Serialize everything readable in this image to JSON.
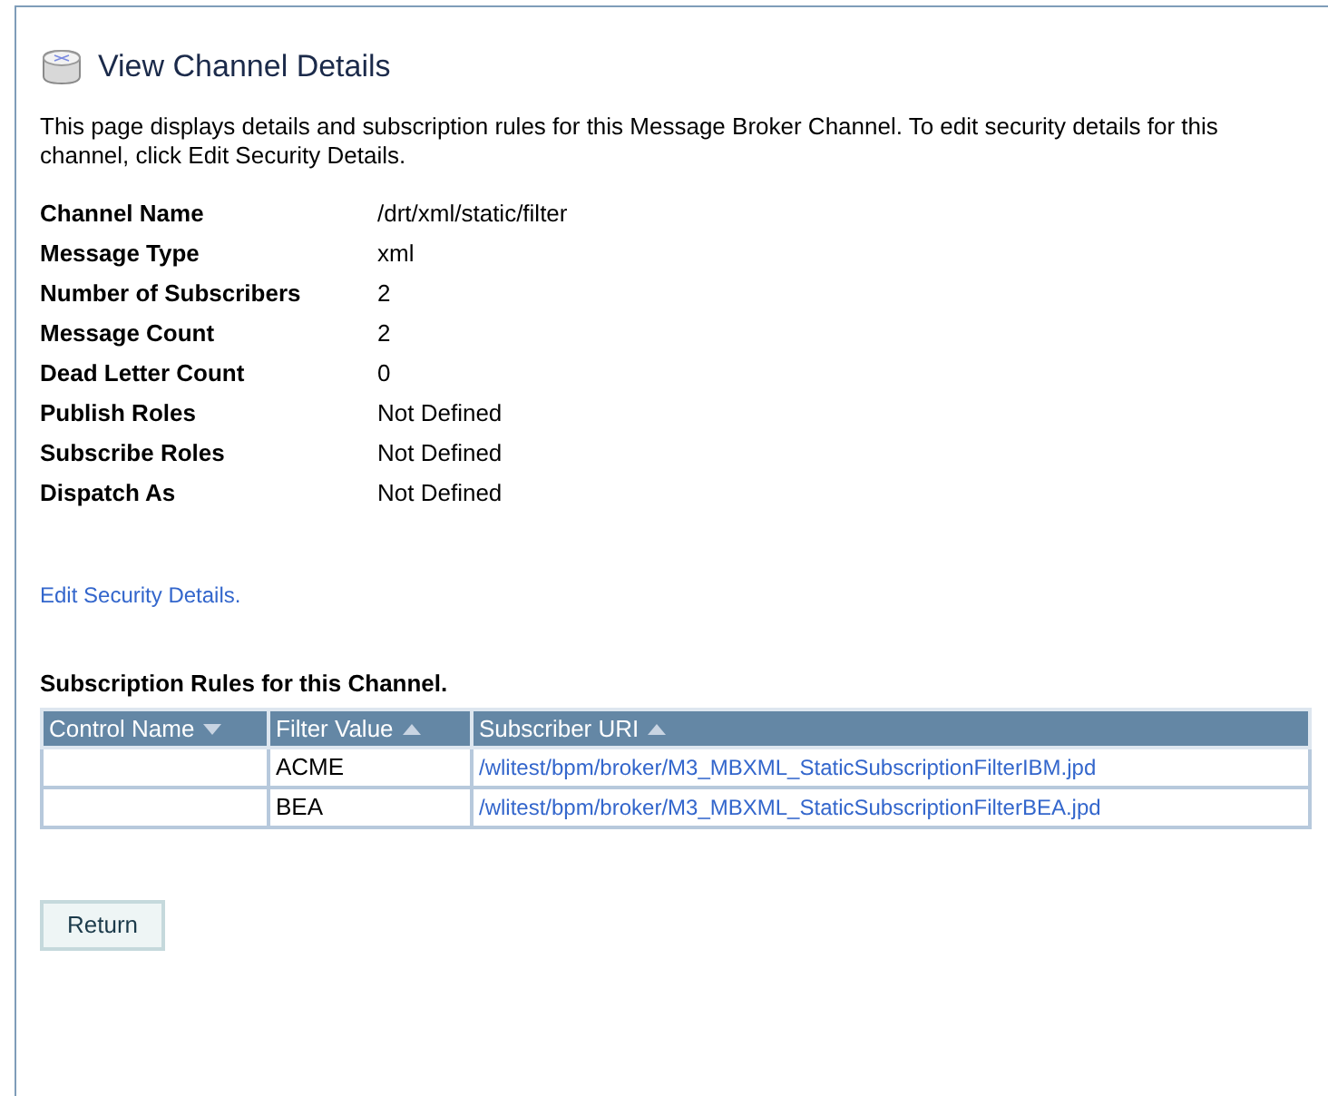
{
  "page": {
    "title": "View Channel Details",
    "description": "This page displays details and subscription rules for this Message Broker Channel. To edit security details for this channel, click Edit Security Details."
  },
  "details": [
    {
      "label": "Channel Name",
      "value": "/drt/xml/static/filter"
    },
    {
      "label": "Message Type",
      "value": "xml"
    },
    {
      "label": "Number of Subscribers",
      "value": "2"
    },
    {
      "label": "Message Count",
      "value": "2"
    },
    {
      "label": "Dead Letter Count",
      "value": "0"
    },
    {
      "label": "Publish Roles",
      "value": "Not Defined"
    },
    {
      "label": "Subscribe Roles",
      "value": "Not Defined"
    },
    {
      "label": "Dispatch As",
      "value": "Not Defined"
    }
  ],
  "edit_link": "Edit Security Details.",
  "table": {
    "title": "Subscription Rules for this Channel.",
    "columns": [
      {
        "label": "Control Name",
        "ascending": false
      },
      {
        "label": "Filter Value",
        "ascending": true
      },
      {
        "label": "Subscriber URI",
        "ascending": true
      }
    ],
    "rows": [
      {
        "filter_value": "ACME",
        "subscriber_uri": "/wlitest/bpm/broker/M3_MBXML_StaticSubscriptionFilterIBM.jpd"
      },
      {
        "filter_value": "BEA",
        "subscriber_uri": "/wlitest/bpm/broker/M3_MBXML_StaticSubscriptionFilterBEA.jpd"
      }
    ]
  },
  "buttons": [
    "Return"
  ]
}
